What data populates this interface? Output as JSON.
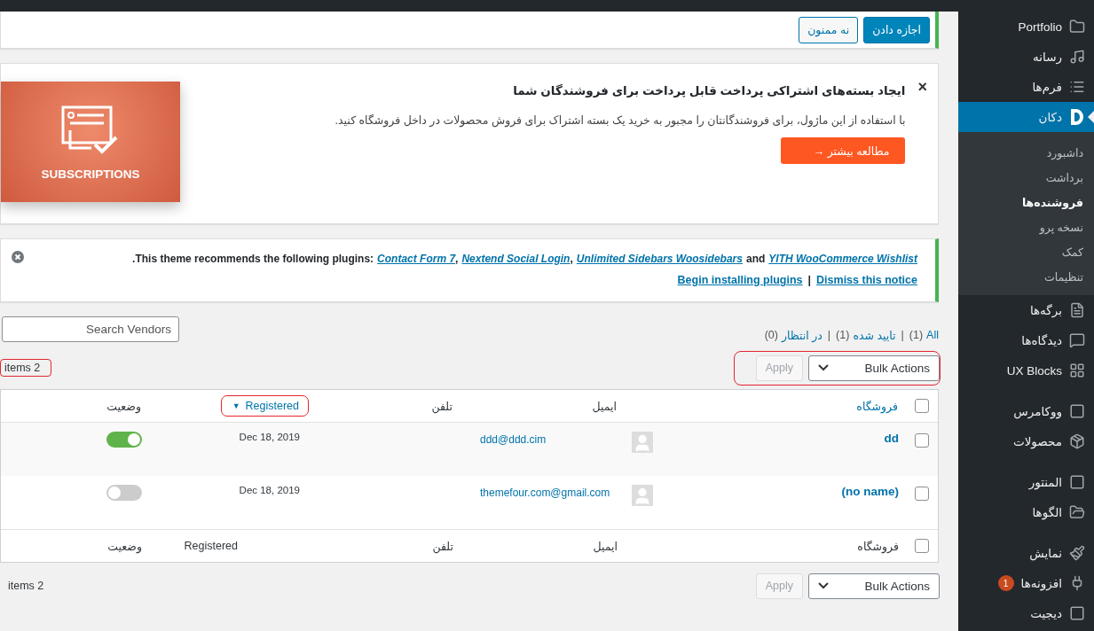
{
  "tracking_notice": {
    "buttons": [
      {
        "label": "اجازه دادن",
        "kind": "primary"
      },
      {
        "label": "نه ممنون",
        "kind": "secondary"
      }
    ]
  },
  "promo_notice": {
    "close": "×",
    "title": "ایجاد بسته‌های اشتراکی پرداخت قابل پرداخت برای فروشندگان شما",
    "text": "با استفاده از این ماژول، برای فروشندگانتان را مجبور به خرید یک بسته اشتراک برای فروش محصولات در داخل فروشگاه کنید.",
    "button": "مطالعه بیشتر →",
    "banner_text": "SUBSCRIPTIONS"
  },
  "plugins_notice": {
    "intro": ".This theme recommends the following plugins:",
    "parts": [
      {
        "kind": "link",
        "text": "YITH WooCommerce Wishlist"
      },
      {
        "kind": "text",
        "text": "and"
      },
      {
        "kind": "link",
        "text": "Unlimited Sidebars Woosidebars"
      },
      {
        "kind": "text",
        "text": ","
      },
      {
        "kind": "link",
        "text": "Nextend Social Login"
      },
      {
        "kind": "text",
        "text": ","
      },
      {
        "kind": "link",
        "text": "Contact Form 7"
      }
    ],
    "actions": [
      "Dismiss this notice",
      "Begin installing plugins"
    ],
    "separator": "|"
  },
  "views": {
    "items": [
      {
        "label": "All",
        "count": "(1)"
      },
      {
        "label": "تایید شده",
        "count": "(1)"
      },
      {
        "label": "در انتظار",
        "count": "(0)"
      }
    ],
    "separator": "|"
  },
  "search": {
    "placeholder": "Search Vendors"
  },
  "top_nav": {
    "count": "items 2",
    "count_highlighted": true,
    "bulk": "Bulk Actions",
    "apply": "Apply",
    "apply_disabled": true,
    "bulk_highlighted": true
  },
  "bottom_nav": {
    "count": "items 2",
    "count_highlighted": false,
    "bulk": "Bulk Actions",
    "apply": "Apply",
    "apply_disabled": true,
    "bulk_highlighted": false
  },
  "table": {
    "header_checked": false,
    "footer_checked": false,
    "columns": [
      {
        "label": "فروشگاه",
        "link": true,
        "highlighted": false
      },
      {
        "label": "ایمیل",
        "link": false,
        "highlighted": false
      },
      {
        "label": "تلفن",
        "link": false,
        "highlighted": false
      },
      {
        "label": "Registered",
        "link": true,
        "sort_indicator": "▼",
        "highlighted": true
      },
      {
        "label": "وضعیت",
        "link": false,
        "highlighted": false
      }
    ],
    "footer_columns": [
      "فروشگاه",
      "ایمیل",
      "تلفن",
      "Registered",
      "وضعیت"
    ],
    "rows": [
      {
        "store": "dd",
        "email": "ddd@ddd.cim",
        "registered": "Dec 18, 2019",
        "enabled": true,
        "checked": false
      },
      {
        "store": "(no name)",
        "email": "themefour.com@gmail.com",
        "registered": "Dec 18, 2019",
        "enabled": false,
        "checked": false
      }
    ]
  },
  "menu": [
    {
      "kind": "item",
      "label": "Portfolio",
      "selected": false
    },
    {
      "kind": "item",
      "label": "رسانه",
      "selected": false
    },
    {
      "kind": "item",
      "label": "فرم‌ها",
      "selected": false
    },
    {
      "kind": "item",
      "label": "دکان",
      "selected": true,
      "children": [
        {
          "label": "داشبورد",
          "selected": false
        },
        {
          "label": "برداشت",
          "selected": false
        },
        {
          "label": "فروشنده‌ها",
          "selected": true
        },
        {
          "label": "نسخه پرو",
          "selected": false
        },
        {
          "label": "کمک",
          "selected": false
        },
        {
          "label": "تنظیمات",
          "selected": false
        }
      ]
    },
    {
      "kind": "item",
      "label": "برگه‌ها",
      "selected": false
    },
    {
      "kind": "item",
      "label": "دیدگاه‌ها",
      "selected": false
    },
    {
      "kind": "item",
      "label": "UX Blocks",
      "selected": false
    },
    {
      "kind": "separator"
    },
    {
      "kind": "item",
      "label": "ووکامرس",
      "selected": false
    },
    {
      "kind": "item",
      "label": "محصولات",
      "selected": false
    },
    {
      "kind": "separator"
    },
    {
      "kind": "item",
      "label": "المنتور",
      "selected": false
    },
    {
      "kind": "item",
      "label": "الگوها",
      "selected": false
    },
    {
      "kind": "separator"
    },
    {
      "kind": "item",
      "label": "نمایش",
      "selected": false
    },
    {
      "kind": "item",
      "label": "افزونه‌ها",
      "selected": false,
      "badge": "1"
    },
    {
      "kind": "item",
      "label": "دیجیت",
      "selected": false
    }
  ]
}
